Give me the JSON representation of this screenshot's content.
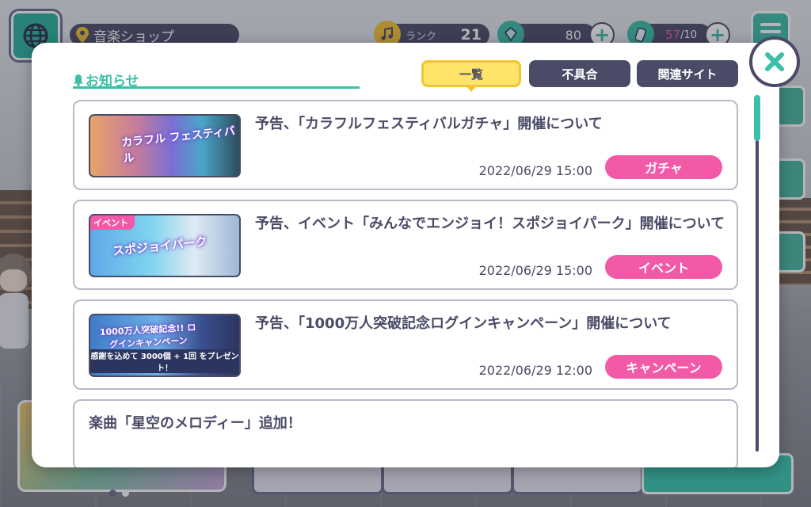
{
  "hud": {
    "location": "音楽ショップ",
    "rank_label": "ランク",
    "rank_value": "21",
    "crystals": "80",
    "stamina": "57",
    "stamina_max": "/10"
  },
  "modal": {
    "title": "お知らせ",
    "tabs": [
      {
        "label": "一覧",
        "active": true
      },
      {
        "label": "不具合",
        "active": false
      },
      {
        "label": "関連サイト",
        "active": false
      }
    ],
    "items": [
      {
        "title": "予告、「カラフルフェスティバルガチャ」開催について",
        "date": "2022/06/29 15:00",
        "badge": "ガチャ",
        "thumb_tag": "",
        "thumb_title": "カラフル フェスティバル",
        "thumb_sub": ""
      },
      {
        "title": "予告、イベント「みんなでエンジョイ！スポジョイパーク」開催について",
        "date": "2022/06/29 15:00",
        "badge": "イベント",
        "thumb_tag": "イベント",
        "thumb_title": "スポジョイパーク",
        "thumb_sub": ""
      },
      {
        "title": "予告、「1000万人突破記念ログインキャンペーン」開催について",
        "date": "2022/06/29 12:00",
        "badge": "キャンペーン",
        "thumb_tag": "",
        "thumb_title": "1000万人突破記念!! ログインキャンペーン",
        "thumb_sub": "感謝を込めて 3000個 + 1回 をプレゼント！"
      },
      {
        "title": "楽曲「星空のメロディー」追加！",
        "date": "",
        "badge": "",
        "thumb_tag": "",
        "thumb_title": "",
        "thumb_sub": ""
      }
    ]
  },
  "colors": {
    "accent": "#3bbfa6",
    "navy": "#4a4b66",
    "pink": "#f25aa7",
    "yellow": "#ffe36b"
  }
}
